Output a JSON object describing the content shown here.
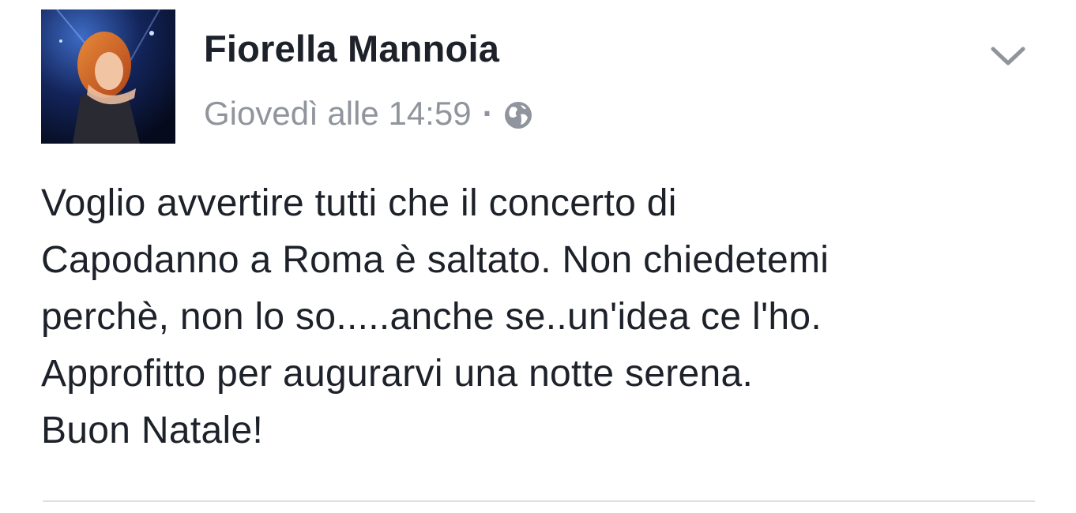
{
  "post": {
    "author": "Fiorella Mannoia",
    "timestamp": "Giovedì alle 14:59",
    "separator": "·",
    "audience_icon": "globe-icon",
    "menu_icon": "chevron-down-icon",
    "text": "Voglio avvertire tutti che il concerto di\nCapodanno a Roma è saltato. Non chiedetemi\nperchè, non lo so.....anche se..un'idea ce l'ho.\nApprofitto per augurarvi una notte serena.\nBuon Natale!"
  },
  "colors": {
    "text_primary": "#1d2129",
    "text_secondary": "#90949c",
    "divider": "#dddfe2"
  }
}
